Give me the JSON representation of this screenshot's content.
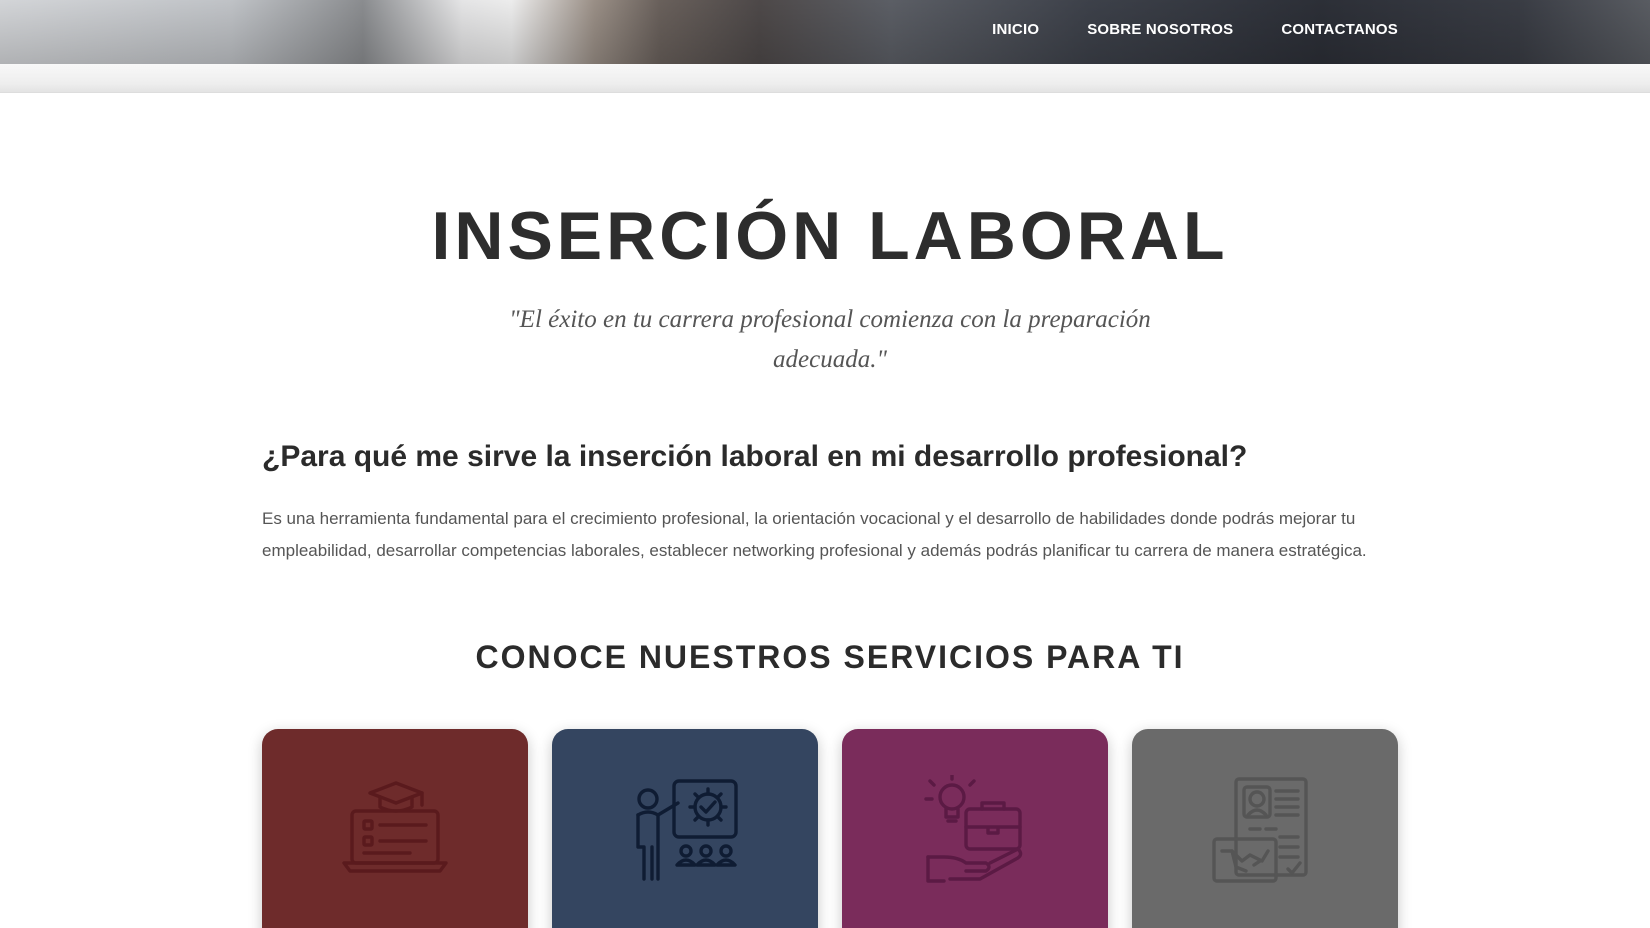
{
  "nav": {
    "items": [
      {
        "label": "INICIO"
      },
      {
        "label": "SOBRE NOSOTROS"
      },
      {
        "label": "CONTACTANOS"
      }
    ]
  },
  "main": {
    "title": "INSERCIÓN LABORAL",
    "quote": "\"El éxito en tu carrera profesional comienza con la preparación adecuada.\"",
    "question": "¿Para qué me sirve la inserción laboral en mi desarrollo profesional?",
    "paragraph": "Es una herramienta fundamental para el crecimiento profesional, la orientación vocacional y el desarrollo de habilidades donde podrás mejorar tu empleabilidad, desarrollar competencias laborales, establecer networking profesional y además podrás planificar tu carrera de manera estratégica.",
    "services_title": "CONOCE NUESTROS SERVICIOS PARA TI"
  },
  "cards": [
    {
      "icon": "online-course-laptop-icon",
      "bg": "#6e2b2b",
      "stroke": "#5a1a1d"
    },
    {
      "icon": "presentation-training-icon",
      "bg": "#344560",
      "stroke": "#0f1c33"
    },
    {
      "icon": "idea-briefcase-hand-icon",
      "bg": "#7a2c5b",
      "stroke": "#5b1a44"
    },
    {
      "icon": "job-application-handshake-icon",
      "bg": "#6a6a6a",
      "stroke": "#555555"
    }
  ]
}
